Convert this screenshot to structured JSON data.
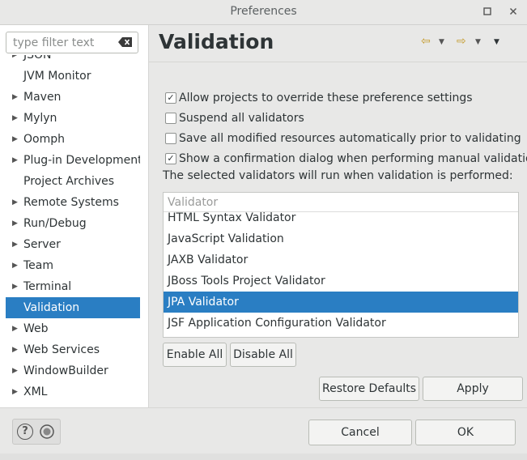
{
  "window": {
    "title": "Preferences"
  },
  "filter": {
    "placeholder": "type filter text",
    "value": ""
  },
  "tree": {
    "items": [
      {
        "label": "JSON",
        "has_children": true,
        "selected": false
      },
      {
        "label": "JVM Monitor",
        "has_children": false,
        "selected": false
      },
      {
        "label": "Maven",
        "has_children": true,
        "selected": false
      },
      {
        "label": "Mylyn",
        "has_children": true,
        "selected": false
      },
      {
        "label": "Oomph",
        "has_children": true,
        "selected": false
      },
      {
        "label": "Plug-in Development",
        "has_children": true,
        "selected": false
      },
      {
        "label": "Project Archives",
        "has_children": false,
        "selected": false
      },
      {
        "label": "Remote Systems",
        "has_children": true,
        "selected": false
      },
      {
        "label": "Run/Debug",
        "has_children": true,
        "selected": false
      },
      {
        "label": "Server",
        "has_children": true,
        "selected": false
      },
      {
        "label": "Team",
        "has_children": true,
        "selected": false
      },
      {
        "label": "Terminal",
        "has_children": true,
        "selected": false
      },
      {
        "label": "Validation",
        "has_children": false,
        "selected": true
      },
      {
        "label": "Web",
        "has_children": true,
        "selected": false
      },
      {
        "label": "Web Services",
        "has_children": true,
        "selected": false
      },
      {
        "label": "WindowBuilder",
        "has_children": true,
        "selected": false
      },
      {
        "label": "XML",
        "has_children": true,
        "selected": false
      }
    ]
  },
  "page": {
    "title": "Validation",
    "options": [
      {
        "label": "Allow projects to override these preference settings",
        "checked": true
      },
      {
        "label": "Suspend all validators",
        "checked": false
      },
      {
        "label": "Save all modified resources automatically prior to validating",
        "checked": false
      },
      {
        "label": "Show a confirmation dialog when performing manual validations",
        "checked": true
      }
    ],
    "info": "The selected validators will run when validation is performed:",
    "table_header": "Validator",
    "validators": [
      {
        "label": "HTML Syntax Validator",
        "selected": false
      },
      {
        "label": "JavaScript Validation",
        "selected": false
      },
      {
        "label": "JAXB Validator",
        "selected": false
      },
      {
        "label": "JBoss Tools Project Validator",
        "selected": false
      },
      {
        "label": "JPA Validator",
        "selected": true
      },
      {
        "label": "JSF Application Configuration Validator",
        "selected": false
      }
    ],
    "enable_all": "Enable All",
    "disable_all": "Disable All",
    "restore_defaults": "Restore Defaults",
    "apply": "Apply"
  },
  "footer": {
    "help_icon": "?",
    "cancel": "Cancel",
    "ok": "OK"
  },
  "colors": {
    "selection": "#2a7ec3",
    "background": "#e8e8e7"
  }
}
